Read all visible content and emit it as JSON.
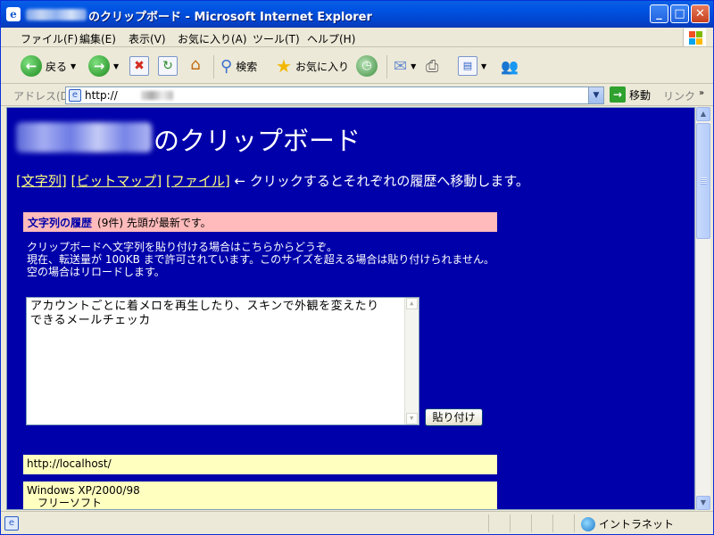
{
  "window": {
    "title": "のクリップボード - Microsoft Internet Explorer",
    "minimize": "_",
    "maximize": "□",
    "close": "✕"
  },
  "menu": {
    "items": [
      "ファイル(F)",
      "編集(E)",
      "表示(V)",
      "お気に入り(A)",
      "ツール(T)",
      "ヘルプ(H)"
    ]
  },
  "toolbar": {
    "back_label": "戻る",
    "search_label": "検索",
    "favorites_label": "お気に入り"
  },
  "address": {
    "label": "アドレス(D)",
    "url": "http://",
    "go_label": "移動",
    "links_label": "リンク"
  },
  "page": {
    "title": "のクリップボード",
    "nav_links": [
      "[文字列]",
      "[ビットマップ]",
      "[ファイル]"
    ],
    "nav_text": "← クリックするとそれぞれの履歴へ移動します。",
    "section_title": "文字列の履歴",
    "section_count": "(9件)",
    "section_note": "先頭が最新です。",
    "info_lines": [
      "クリップボードへ文字列を貼り付ける場合はこちらからどうぞ。",
      "現在、転送量が 100KB まで許可されています。このサイズを超える場合は貼り付けられません。",
      "空の場合はリロードします。"
    ],
    "textarea_value": "アカウントごとに着メロを再生したり、スキンで外観を変えたり\nできるメールチェッカ",
    "paste_button": "貼り付け",
    "entries": [
      "http://localhost/",
      "Windows XP/2000/98\n　フリーソフト"
    ]
  },
  "status": {
    "zone": "イントラネット"
  },
  "colors": {
    "page_bg": "#0000aa",
    "link": "#ffff80",
    "section_bg": "#ffbbbb",
    "entry_bg": "#ffffc0"
  }
}
